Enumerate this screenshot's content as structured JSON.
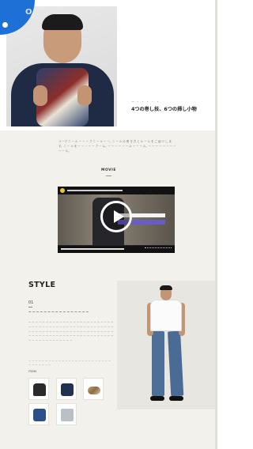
{
  "corner": {
    "label": "O"
  },
  "hero": {
    "tag": "— ・ ・ ・ ・ ・",
    "title": "4つの巻し技、6つの挿し小物"
  },
  "intro": {
    "text": "ユ ーブ ニ ー ル ー ー ー ブ ニ ー ル ー ー。ニ ー ル の 巻 き 方 と ル ー ル を ご 紹 介 し ま す。ニ ー ル を ー ー ー ー ー ブ ー ル。ー ー ー ー ー ー ル ー ー ー ル。ー ー ー ー ー ー ー ー ー ー ル。"
  },
  "movie": {
    "label": "MOVIE"
  },
  "video": {
    "caption_line1": "",
    "caption_line2": ""
  },
  "style": {
    "heading": "STYLE",
    "number": "01",
    "subtitle": "ー ー ー ー ー ー ー ー ー ー ー ー ー ー ー ー",
    "body": "ー ー ー ー ー ー ー ー ー ー ー ー ー ー ー ー ー ー ー ー ー ー ー ー ー ー ー ー ー ー ー ー ー ー ー ー ー ー ー ー ー ー ー ー ー ー ー ー ー ー ー ー ー ー ー ー ー ー ー ー ー ー ー ー ー ー ー ー ー ー ー ー ー ー ー ー ー ー ー ー ー ー ー ー ー ー ー ー ー ー ー ー ー ー ー ー ー ー ー ー ー ー ー ー ー ー ー ー ー ー ー ー ー",
    "note": "ー ー ー ー ー ー ー ー ー ー ー ー ー ー ー ー ー ー ー ー ー ー ー ー ー ー ー ー ー ー ー ー",
    "items_label": "ITEMS"
  },
  "items": [
    {
      "name": "bag-black"
    },
    {
      "name": "bag-navy"
    },
    {
      "name": "scarf-print"
    },
    {
      "name": "bag-blue"
    },
    {
      "name": "tote-grey"
    }
  ],
  "colors": {
    "accent": "#1e6fd6",
    "tag": "#4a8fcf",
    "background": "#f3f1ec"
  }
}
